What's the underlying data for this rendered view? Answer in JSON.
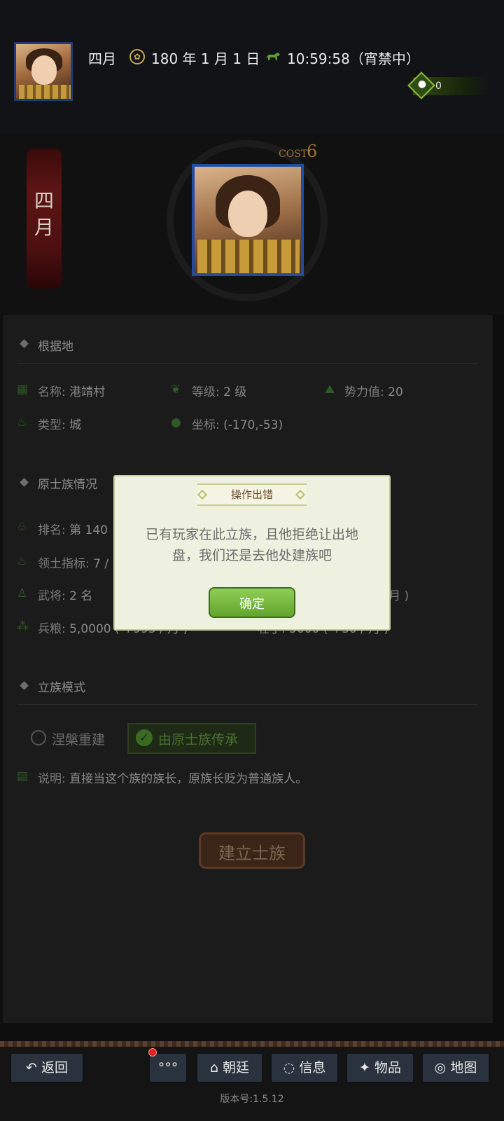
{
  "header": {
    "player_name": "四月",
    "date": "180 年 1 月 1 日",
    "time": "10:59:58（宵禁中）",
    "resource_value": "0",
    "date_icon": "calendar-seal-icon",
    "time_icon": "horse-icon",
    "resource_icon": "money-bag-icon"
  },
  "hero": {
    "name_banner": "四月",
    "cost_label": "COST",
    "cost_value": "6"
  },
  "base": {
    "title": "根据地",
    "name_label": "名称:",
    "name_value": "港靖村",
    "level_label": "等级:",
    "level_value": "2 级",
    "power_label": "势力值:",
    "power_value": "20",
    "type_label": "类型:",
    "type_value": "城",
    "coord_label": "坐标:",
    "coord_value": "(-170,-53)"
  },
  "clan": {
    "title": "原士族情况",
    "rank_label": "排名:",
    "rank_value": "第 140",
    "territory_label": "领土指标:",
    "territory_value": "7 /",
    "generals_label": "武将:",
    "generals_value": "2 名",
    "generals_right_value": "/ 月 )",
    "food_label": "兵粮:",
    "food_value": "5,0000 ( +995 / 月 )",
    "men_label": "壮丁:",
    "men_value": "5000 ( +30 / 月 )"
  },
  "mode": {
    "title": "立族模式",
    "option1": "涅槃重建",
    "option2": "由原士族传承",
    "desc_label": "说明:",
    "desc_value": "直接当这个族的族长，原族长贬为普通族人。",
    "build_button": "建立士族"
  },
  "dialog": {
    "title": "操作出错",
    "message_line1": "已有玩家在此立族，且他拒绝让出地",
    "message_line2": "盘，我们还是去他处建族吧",
    "ok_button": "确定"
  },
  "nav": {
    "back": "返回",
    "more": "°°°",
    "court": "朝廷",
    "info": "信息",
    "items": "物品",
    "map": "地图"
  },
  "version": "版本号:1.5.12",
  "colors": {
    "accent_green": "#63a52e",
    "dialog_bg": "#eef1df",
    "nav_button": "#2a323d",
    "notification_red": "#e02222"
  }
}
